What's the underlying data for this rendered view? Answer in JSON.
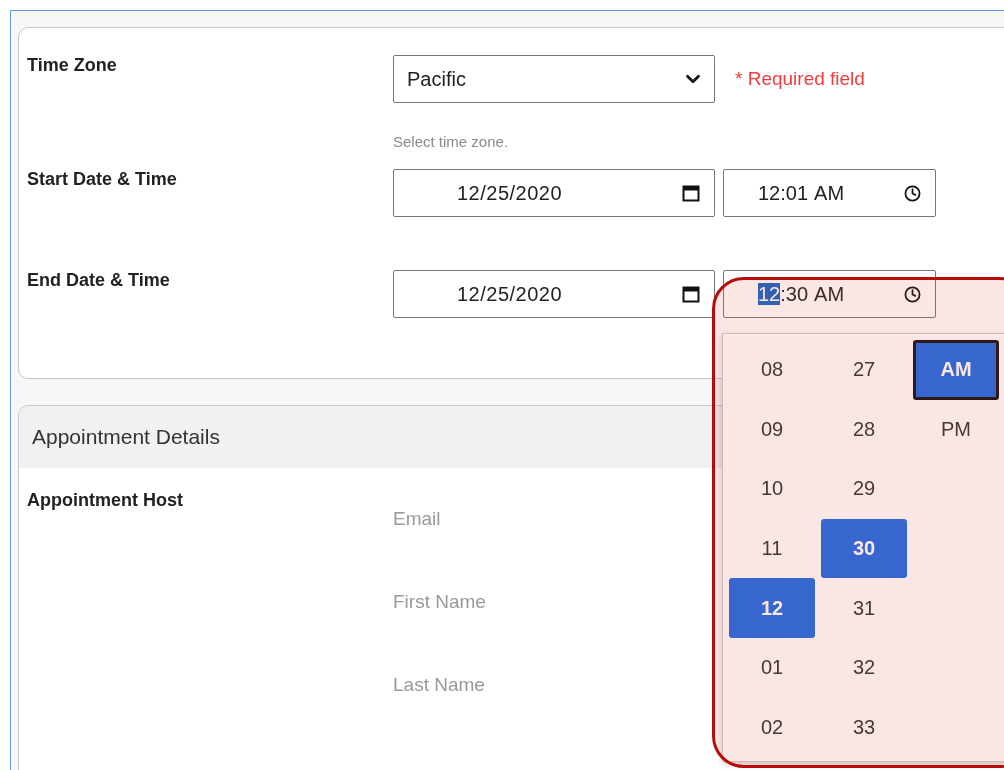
{
  "schedule": {
    "time_zone": {
      "label": "Time Zone",
      "value": "Pacific",
      "required_note": "* Required field",
      "hint": "Select time zone."
    },
    "rows": [
      {
        "label": "Start Date & Time",
        "date": "12/25/2020",
        "time_segments": [
          {
            "text": "12",
            "selected": false
          },
          {
            "text": ":01",
            "selected": false
          },
          {
            "text": "AM",
            "selected": false
          }
        ]
      },
      {
        "label": "End Date & Time",
        "date": "12/25/2020",
        "time_segments": [
          {
            "text": "12",
            "selected": true
          },
          {
            "text": ":30",
            "selected": false
          },
          {
            "text": "AM",
            "selected": false
          }
        ]
      }
    ]
  },
  "time_picker": {
    "hours": [
      {
        "text": "08",
        "selected": false
      },
      {
        "text": "09",
        "selected": false
      },
      {
        "text": "10",
        "selected": false
      },
      {
        "text": "11",
        "selected": false
      },
      {
        "text": "12",
        "selected": true
      },
      {
        "text": "01",
        "selected": false
      },
      {
        "text": "02",
        "selected": false
      }
    ],
    "minutes": [
      {
        "text": "27",
        "selected": false
      },
      {
        "text": "28",
        "selected": false
      },
      {
        "text": "29",
        "selected": false
      },
      {
        "text": "30",
        "selected": true
      },
      {
        "text": "31",
        "selected": false
      },
      {
        "text": "32",
        "selected": false
      },
      {
        "text": "33",
        "selected": false
      }
    ],
    "periods": [
      {
        "text": "AM",
        "selected": true
      },
      {
        "text": "PM",
        "selected": false
      }
    ]
  },
  "appointment_details": {
    "title": "Appointment Details",
    "host": {
      "label": "Appointment Host",
      "fields": [
        {
          "placeholder": "Email"
        },
        {
          "placeholder": "First Name"
        },
        {
          "placeholder": "Last Name"
        }
      ]
    }
  }
}
